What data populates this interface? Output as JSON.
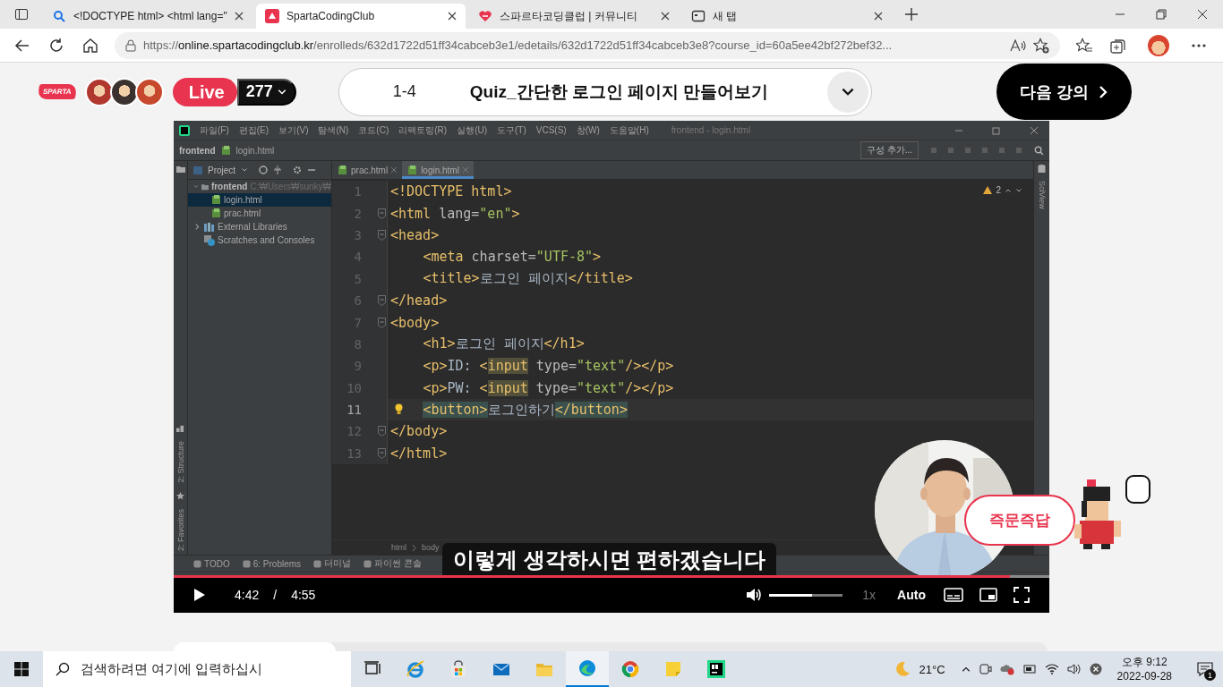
{
  "browser": {
    "tabs": [
      {
        "kind": "search",
        "title": "<!DOCTYPE html> <html lang=\"",
        "selected": false
      },
      {
        "kind": "site",
        "title": "SpartaCodingClub",
        "selected": true
      },
      {
        "kind": "community",
        "title": "스파르타코딩클럽 | 커뮤니티",
        "selected": false
      },
      {
        "kind": "newtab",
        "title": "새 탭",
        "selected": false
      }
    ],
    "url": {
      "prefix": "https://",
      "host": "online.spartacodingclub.kr",
      "path": "/enrolleds/632d1722d51ff34cabceb3e1/edetails/632d1722d51ff34cabceb3e8?course_id=60a5ee42bf272bef32..."
    }
  },
  "header": {
    "logo": "SPARTA",
    "live": "Live",
    "viewers": "277",
    "lesson_number": "1-4",
    "lesson_title": "Quiz_간단한 로그인 페이지 만들어보기",
    "next_button": "다음 강의"
  },
  "ide": {
    "menu": [
      "파일(F)",
      "편집(E)",
      "보기(V)",
      "탐색(N)",
      "코드(C)",
      "리팩토링(R)",
      "실행(U)",
      "도구(T)",
      "VCS(S)",
      "창(W)",
      "도움말(H)"
    ],
    "window_title": "frontend - login.html",
    "nav_project": "frontend",
    "nav_file": "login.html",
    "run_config": "구성 추가...",
    "project_label": "Project",
    "tree": [
      {
        "kind": "folder",
        "label": "frontend",
        "path": "C:₩Users₩sunky₩",
        "expanded": true,
        "selected": false,
        "children": [
          {
            "kind": "file",
            "label": "login.html",
            "selected": true
          },
          {
            "kind": "file",
            "label": "prac.html",
            "selected": false
          }
        ]
      },
      {
        "kind": "library",
        "label": "External Libraries",
        "expanded": false,
        "selected": false
      },
      {
        "kind": "scratch",
        "label": "Scratches and Consoles",
        "selected": false
      }
    ],
    "editor_tabs": [
      {
        "title": "prac.html",
        "selected": false
      },
      {
        "title": "login.html",
        "selected": true
      }
    ],
    "side_tools": [
      "2: Structure",
      "2: Favorites"
    ],
    "right_tools": [
      "SciView"
    ],
    "warnings": "2",
    "lines": [
      {
        "number": "1",
        "fold": false,
        "current": false,
        "bulb": false,
        "tokens": [
          {
            "kind": "tag",
            "text": "<!DOCTYPE html>"
          }
        ]
      },
      {
        "number": "2",
        "fold": true,
        "current": false,
        "bulb": false,
        "tokens": [
          {
            "kind": "tag",
            "text": "<html"
          },
          {
            "kind": "attr",
            "text": " lang="
          },
          {
            "kind": "str",
            "text": "\"en\""
          },
          {
            "kind": "tag",
            "text": ">"
          }
        ]
      },
      {
        "number": "3",
        "fold": true,
        "current": false,
        "bulb": false,
        "tokens": [
          {
            "kind": "tag",
            "text": "<head>"
          }
        ],
        "children": [
          {
            "number": "4",
            "fold": false,
            "current": false,
            "bulb": false,
            "tokens": [
              {
                "kind": "tag",
                "text": "<meta"
              },
              {
                "kind": "attr",
                "text": " charset="
              },
              {
                "kind": "str",
                "text": "\"UTF-8\""
              },
              {
                "kind": "tag",
                "text": ">"
              }
            ]
          },
          {
            "number": "5",
            "fold": false,
            "current": false,
            "bulb": false,
            "tokens": [
              {
                "kind": "tag",
                "text": "<title>"
              },
              {
                "kind": "text",
                "text": "로그인 페이지"
              },
              {
                "kind": "tag",
                "text": "</title>"
              }
            ]
          }
        ]
      },
      {
        "number": "6",
        "fold": true,
        "current": false,
        "bulb": false,
        "tokens": [
          {
            "kind": "tag",
            "text": "</head>"
          }
        ]
      },
      {
        "number": "7",
        "fold": true,
        "current": false,
        "bulb": false,
        "tokens": [
          {
            "kind": "tag",
            "text": "<body>"
          }
        ],
        "children": [
          {
            "number": "8",
            "fold": false,
            "current": false,
            "bulb": false,
            "tokens": [
              {
                "kind": "tag",
                "text": "<h1>"
              },
              {
                "kind": "text",
                "text": "로그인 페이지"
              },
              {
                "kind": "tag",
                "text": "</h1>"
              }
            ]
          },
          {
            "number": "9",
            "fold": false,
            "current": false,
            "bulb": false,
            "tokens": [
              {
                "kind": "tag",
                "text": "<p>"
              },
              {
                "kind": "text",
                "text": "ID: "
              },
              {
                "kind": "tag",
                "text": "<"
              },
              {
                "kind": "match",
                "text": "input"
              },
              {
                "kind": "attr",
                "text": " type="
              },
              {
                "kind": "str",
                "text": "\"text\""
              },
              {
                "kind": "tag",
                "text": "/></p>"
              }
            ]
          },
          {
            "number": "10",
            "fold": false,
            "current": false,
            "bulb": false,
            "tokens": [
              {
                "kind": "tag",
                "text": "<p>"
              },
              {
                "kind": "text",
                "text": "PW: "
              },
              {
                "kind": "tag",
                "text": "<"
              },
              {
                "kind": "match",
                "text": "input"
              },
              {
                "kind": "attr",
                "text": " type="
              },
              {
                "kind": "str",
                "text": "\"text\""
              },
              {
                "kind": "tag",
                "text": "/></p>"
              }
            ]
          },
          {
            "number": "11",
            "fold": false,
            "current": true,
            "bulb": true,
            "tokens": [
              {
                "kind": "pair",
                "text": "<button>"
              },
              {
                "kind": "text",
                "text": "로그인하기"
              },
              {
                "kind": "pair",
                "text": "</button>"
              }
            ]
          }
        ]
      },
      {
        "number": "12",
        "fold": true,
        "current": false,
        "bulb": false,
        "tokens": [
          {
            "kind": "tag",
            "text": "</body>"
          }
        ]
      },
      {
        "number": "13",
        "fold": true,
        "current": false,
        "bulb": false,
        "tokens": [
          {
            "kind": "tag",
            "text": "</html>"
          }
        ]
      }
    ],
    "breadcrumbs": [
      "html",
      "body"
    ],
    "tool_windows": [
      "TODO",
      "6: Problems",
      "터미널",
      "파이썬 콘솔"
    ]
  },
  "player": {
    "subtitle": "이렇게 생각하시면 편하겠습니다",
    "qa_button": "즉문즉답",
    "progress": {
      "level": 0.955
    },
    "current_time": "4:42",
    "separator": "/",
    "duration": "4:55",
    "volume": {
      "level": 0.58
    },
    "speed": "1x",
    "quality": "Auto"
  },
  "taskbar": {
    "search_placeholder": "검색하려면 여기에 입력하십시",
    "apps": [
      {
        "kind": "taskview",
        "selected": false
      },
      {
        "kind": "ie",
        "selected": false
      },
      {
        "kind": "store",
        "selected": false
      },
      {
        "kind": "mail",
        "selected": false
      },
      {
        "kind": "explorer",
        "selected": false
      },
      {
        "kind": "edge",
        "selected": true
      },
      {
        "kind": "chrome",
        "selected": false
      },
      {
        "kind": "sticky",
        "selected": false
      },
      {
        "kind": "pycharm",
        "selected": false
      }
    ],
    "weather": "21°C",
    "time": "오후 9:12",
    "date": "2022-09-28",
    "notifications": "1"
  }
}
